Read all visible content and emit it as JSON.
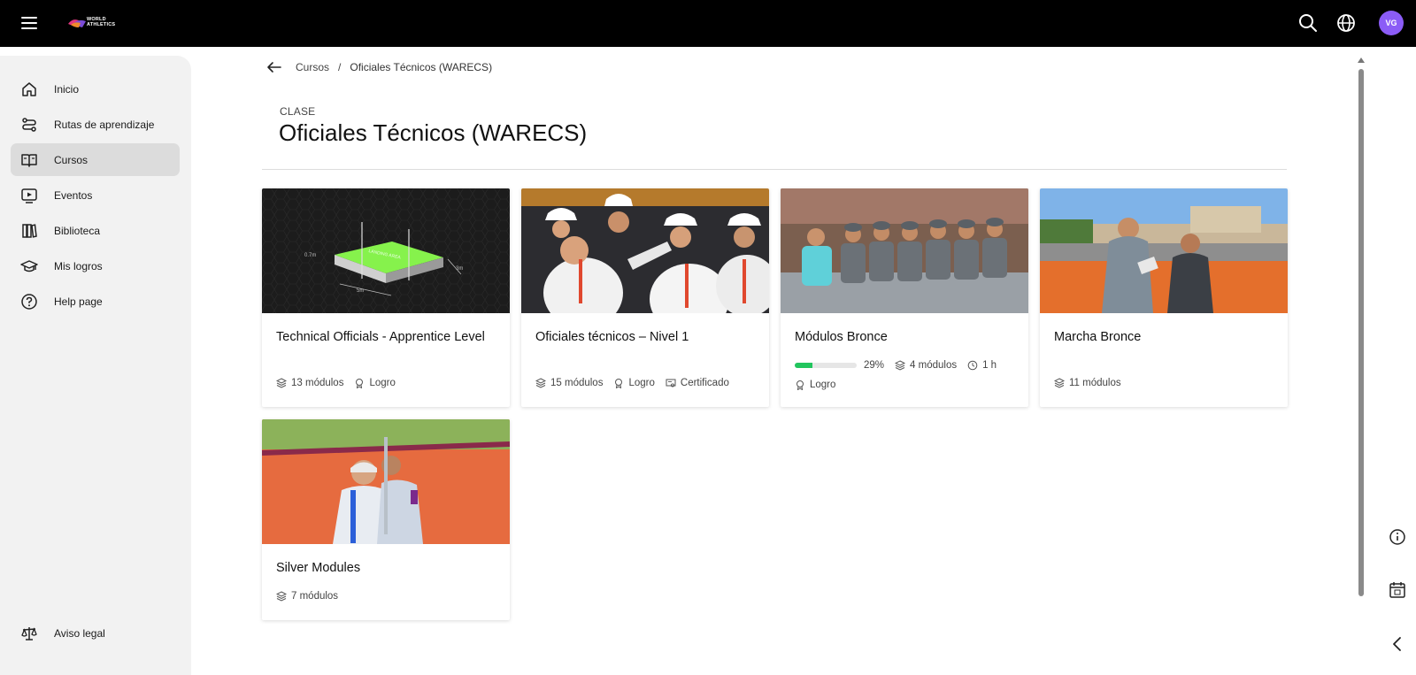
{
  "brand": {
    "logo_line1": "WORLD",
    "logo_line2": "ATHLETICS"
  },
  "user": {
    "initials": "VG"
  },
  "sidebar": {
    "items": [
      {
        "label": "Inicio",
        "icon": "home-icon"
      },
      {
        "label": "Rutas de aprendizaje",
        "icon": "route-icon"
      },
      {
        "label": "Cursos",
        "icon": "book-open-icon",
        "active": true
      },
      {
        "label": "Eventos",
        "icon": "video-icon"
      },
      {
        "label": "Biblioteca",
        "icon": "library-icon"
      },
      {
        "label": "Mis logros",
        "icon": "graduation-cap-icon"
      },
      {
        "label": "Help page",
        "icon": "help-circle-icon"
      }
    ],
    "footer": {
      "label": "Aviso legal",
      "icon": "scales-icon"
    }
  },
  "breadcrumb": {
    "parent": "Cursos",
    "separator": "/",
    "current": "Oficiales Técnicos (WARECS)"
  },
  "header": {
    "kicker": "CLASE",
    "title": "Oficiales Técnicos (WARECS)"
  },
  "cards": [
    {
      "title": "Technical Officials - Apprentice Level",
      "modules": "13 módulos",
      "achievement": "Logro"
    },
    {
      "title": "Oficiales técnicos – Nivel 1",
      "modules": "15 módulos",
      "achievement": "Logro",
      "certificate": "Certificado"
    },
    {
      "title": "Módulos Bronce",
      "progress": 0.29,
      "progress_label": "29%",
      "modules": "4 módulos",
      "duration": "1 h",
      "achievement": "Logro"
    },
    {
      "title": "Marcha Bronce",
      "modules": "11 módulos"
    },
    {
      "title": "Silver Modules",
      "modules": "7 módulos"
    }
  ],
  "image1": {
    "label_top": "LANDING AREA",
    "dim_a": "0.7m",
    "dim_b": "3m",
    "dim_c": "5m"
  },
  "colors": {
    "accent": "#8b5cf6",
    "progress": "#22c55e",
    "active_nav": "#dcdcdc"
  }
}
